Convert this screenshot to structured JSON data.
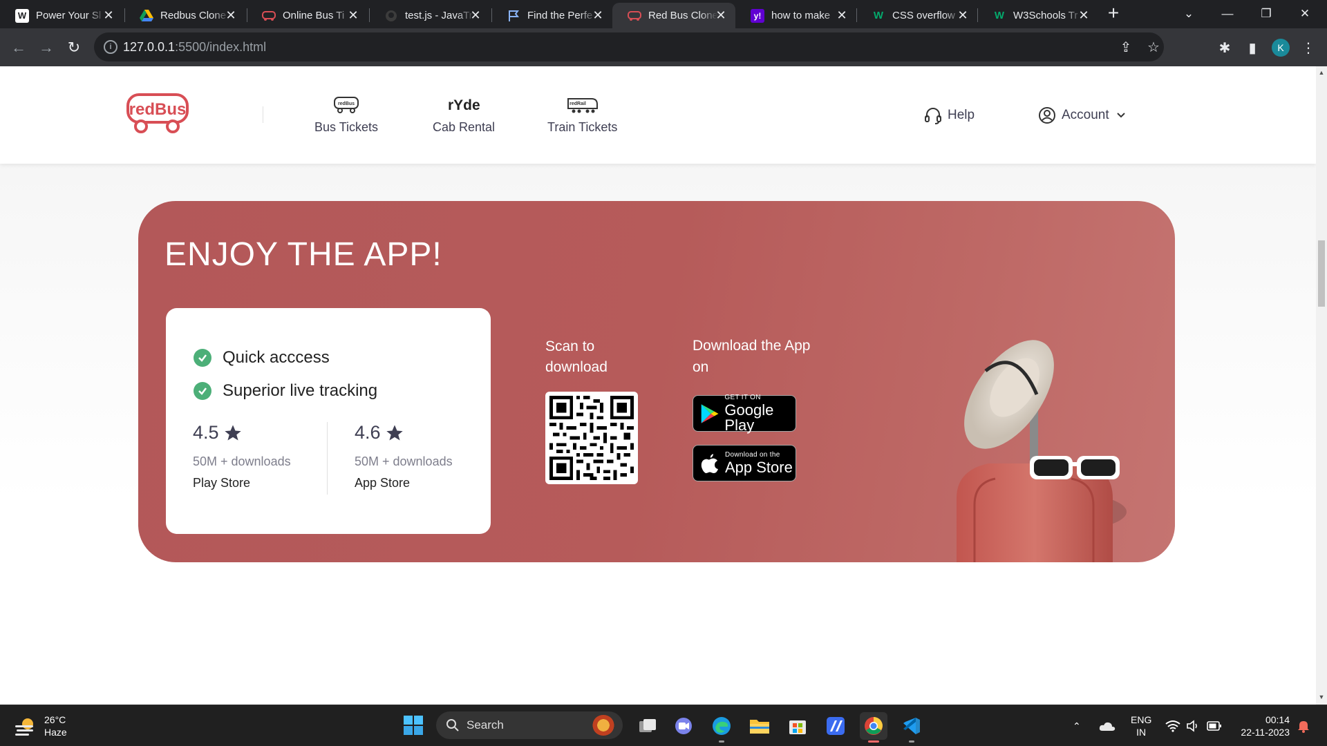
{
  "browser": {
    "tabs": [
      {
        "title": "Power Your Sl",
        "favicon": "wordpress-icon",
        "active": false
      },
      {
        "title": "Redbus Clone",
        "favicon": "google-drive-icon",
        "active": false
      },
      {
        "title": "Online Bus Ti",
        "favicon": "redbus-icon",
        "active": false
      },
      {
        "title": "test.js - JavaTr",
        "favicon": "github-icon",
        "active": false
      },
      {
        "title": "Find the Perfe",
        "favicon": "flag-icon",
        "active": false
      },
      {
        "title": "Red Bus Clone",
        "favicon": "redbus-icon",
        "active": true
      },
      {
        "title": "how to make",
        "favicon": "yahoo-icon",
        "active": false
      },
      {
        "title": "CSS overflow",
        "favicon": "w3schools-icon",
        "active": false
      },
      {
        "title": "W3Schools Tr",
        "favicon": "w3schools-icon",
        "active": false
      }
    ],
    "url_host": "127.0.0.1",
    "url_path": ":5500/index.html",
    "profile_initial": "K"
  },
  "header": {
    "logo_text": "redBus",
    "nav": [
      {
        "label": "Bus Tickets",
        "icon": "bus-icon"
      },
      {
        "label": "Cab Rental",
        "icon": "ryde-icon"
      },
      {
        "label": "Train Tickets",
        "icon": "train-icon"
      }
    ],
    "help_label": "Help",
    "account_label": "Account"
  },
  "banner": {
    "title": "ENJOY THE APP!",
    "features": [
      "Quick acccess",
      "Superior live tracking"
    ],
    "ratings": [
      {
        "score": "4.5",
        "downloads": "50M + downloads",
        "store": "Play Store"
      },
      {
        "score": "4.6",
        "downloads": "50M + downloads",
        "store": "App Store"
      }
    ],
    "scan_text": "Scan to download",
    "download_text": "Download the App on",
    "google_play": {
      "small": "GET IT ON",
      "big": "Google Play"
    },
    "app_store": {
      "small": "Download on the",
      "big": "App Store"
    }
  },
  "taskbar": {
    "weather_temp": "26°C",
    "weather_desc": "Haze",
    "search_label": "Search",
    "lang_top": "ENG",
    "lang_bottom": "IN",
    "time": "00:14",
    "date": "22-11-2023"
  },
  "colors": {
    "brand_red": "#d84e55",
    "banner_bg": "#b35859",
    "check_green": "#4caf78",
    "chrome_dark": "#202124",
    "chrome_toolbar": "#35363a"
  }
}
